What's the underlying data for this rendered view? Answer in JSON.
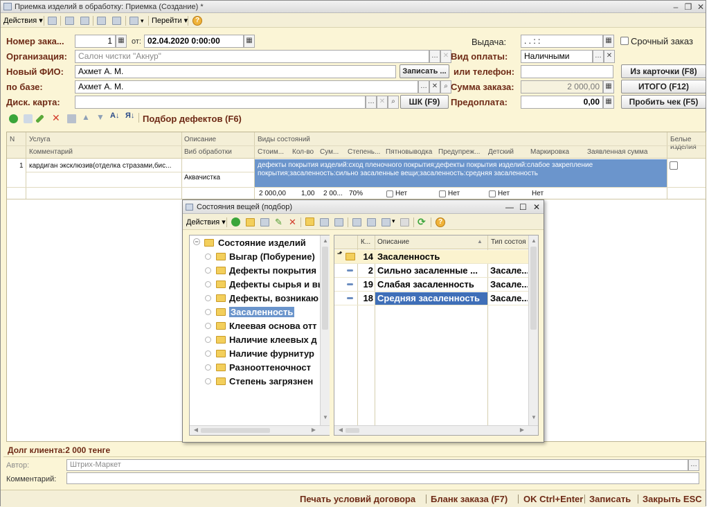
{
  "window": {
    "title": "Приемка изделий в обработку: Приемка (Создание) *"
  },
  "toolbar": {
    "actions_label": "Действия",
    "goto_label": "Перейти"
  },
  "form": {
    "order_number_label": "Номер зака...",
    "order_number": "1",
    "from_label": "от:",
    "order_date": "02.04.2020  0:00:00",
    "issue_label": "Выдача:",
    "issue_value": " .   .      :  :",
    "urgent_label": "Срочный заказ",
    "org_label": "Организация:",
    "org_value": "Салон чистки \"Акнур\"",
    "payment_label": "Вид оплаты:",
    "payment_value": "Наличными",
    "fio_label": "Новый ФИО:",
    "fio_value": "Ахмет А. М.",
    "save_btn": "Записать ...",
    "phone_label": "или телефон:",
    "phone_value": "",
    "from_card_btn": "Из карточки (F8)",
    "base_label": "по базе:",
    "base_value": "Ахмет А. М.",
    "sum_label": "Сумма заказа:",
    "sum_value": "2 000,00",
    "total_btn": "ИТОГО (F12)",
    "disc_label": "Диск. карта:",
    "disc_value": "",
    "barcode_btn": "ШК (F9)",
    "prepay_label": "Предоплата:",
    "prepay_value": "0,00",
    "receipt_btn": "Пробить чек (F5)",
    "defects_link": "Подбор дефектов (F6)"
  },
  "grid": {
    "headers": {
      "n": "N",
      "service": "Услуга",
      "comment": "Комментарий",
      "description": "Описание",
      "process": "Виб обработки",
      "states": "Виды состояний",
      "white": "Белые изделия",
      "sub": [
        "Стоим...",
        "Кол-во",
        "Сум...",
        "Степень...",
        "Пятновыводка",
        "Предупреж...",
        "Детский",
        "Маркировка",
        "Заявленная сумма"
      ]
    },
    "row": {
      "n": "1",
      "service": "кардиган эксклюзив(отделка стразами,бис...",
      "process": "Аквачистка",
      "states": "дефекты покрытия изделий:сход пленочного покрытия;дефекты покрытия изделий:слабое закрепление покрытия;засаленность:сильно засаленные вещи;засаленность:средняя засаленность",
      "price": "2 000,00",
      "qty": "1,00",
      "sum": "2 00...",
      "degree": "70%",
      "stain": "Нет",
      "warn": "Нет",
      "kids": "Нет",
      "mark": "Нет"
    }
  },
  "footer": {
    "debt": "Долг клиента:2 000 тенге",
    "author_label": "Автор:",
    "author_value": "Штрих-Маркет",
    "comment_label": "Комментарий:",
    "comment_value": ""
  },
  "bottom": {
    "print": "Печать условий договора",
    "blank": "Бланк заказа (F7)",
    "ok": "OK Ctrl+Enter",
    "save": "Записать",
    "close": "Закрыть ESC"
  },
  "dialog": {
    "title": "Состояния вещей (подбор)",
    "actions_label": "Действия",
    "tree_root": "Состояние изделий",
    "tree_items": [
      "Выгар (Побурение)",
      "Дефекты покрытия",
      "Дефекты сырья и вы",
      "Дефекты, возникаю",
      "Засаленность",
      "Клеевая основа отт",
      "Наличие клеевых д",
      "Наличие фурнитур",
      "Разнооттеночност",
      "Степень загрязнен"
    ],
    "list_headers": {
      "code": "К...",
      "desc": "Описание",
      "type": "Тип состоя"
    },
    "list_rows": [
      {
        "code": "14",
        "desc": "Засаленность",
        "type": ""
      },
      {
        "code": "2",
        "desc": "Сильно засаленные ...",
        "type": "Засале..."
      },
      {
        "code": "19",
        "desc": "Слабая засаленность",
        "type": "Засале..."
      },
      {
        "code": "18",
        "desc": "Средняя засаленность",
        "type": "Засале..."
      }
    ]
  }
}
